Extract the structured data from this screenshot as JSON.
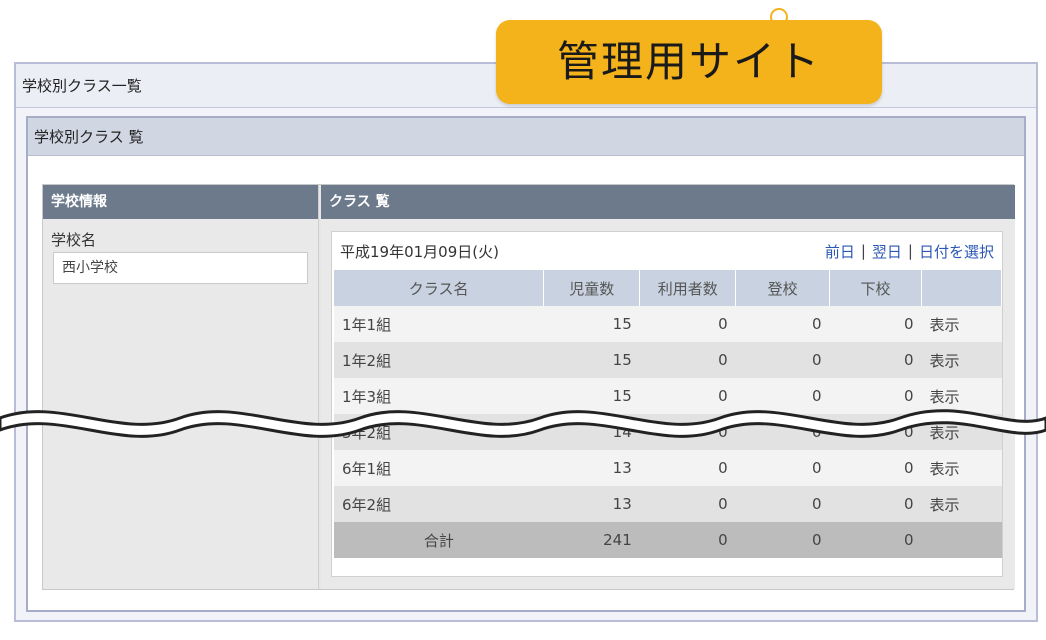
{
  "badge": {
    "label": "管理用サイト"
  },
  "window": {
    "title": "学校別クラス一覧"
  },
  "content": {
    "header": "学校別クラス 覧"
  },
  "school_info": {
    "section_title": "学校情報",
    "name_label": "学校名",
    "name_value": "西小学校"
  },
  "class_list": {
    "section_title": "クラス 覧",
    "date": "平成19年01月09日(火)",
    "nav": {
      "prev": "前日",
      "next": "翌日",
      "select": "日付を選択",
      "separator": "|"
    },
    "columns": [
      "クラス名",
      "児童数",
      "利用者数",
      "登校",
      "下校",
      ""
    ],
    "rows": [
      {
        "name": "1年1組",
        "students": "15",
        "users": "0",
        "arrive": "0",
        "leave": "0",
        "action": "表示"
      },
      {
        "name": "1年2組",
        "students": "15",
        "users": "0",
        "arrive": "0",
        "leave": "0",
        "action": "表示"
      },
      {
        "name": "1年3組",
        "students": "15",
        "users": "0",
        "arrive": "0",
        "leave": "0",
        "action": "表示"
      },
      {
        "name": "5年2組",
        "students": "14",
        "users": "0",
        "arrive": "0",
        "leave": "0",
        "action": "表示"
      },
      {
        "name": "6年1組",
        "students": "13",
        "users": "0",
        "arrive": "0",
        "leave": "0",
        "action": "表示"
      },
      {
        "name": "6年2組",
        "students": "13",
        "users": "0",
        "arrive": "0",
        "leave": "0",
        "action": "表示"
      }
    ],
    "total": {
      "label": "合計",
      "students": "241",
      "users": "0",
      "arrive": "0",
      "leave": "0"
    }
  },
  "colors": {
    "badge": "#f4b21b",
    "section_header": "#6d7a8c",
    "table_header": "#c8d2e0",
    "link": "#2a57b5"
  }
}
